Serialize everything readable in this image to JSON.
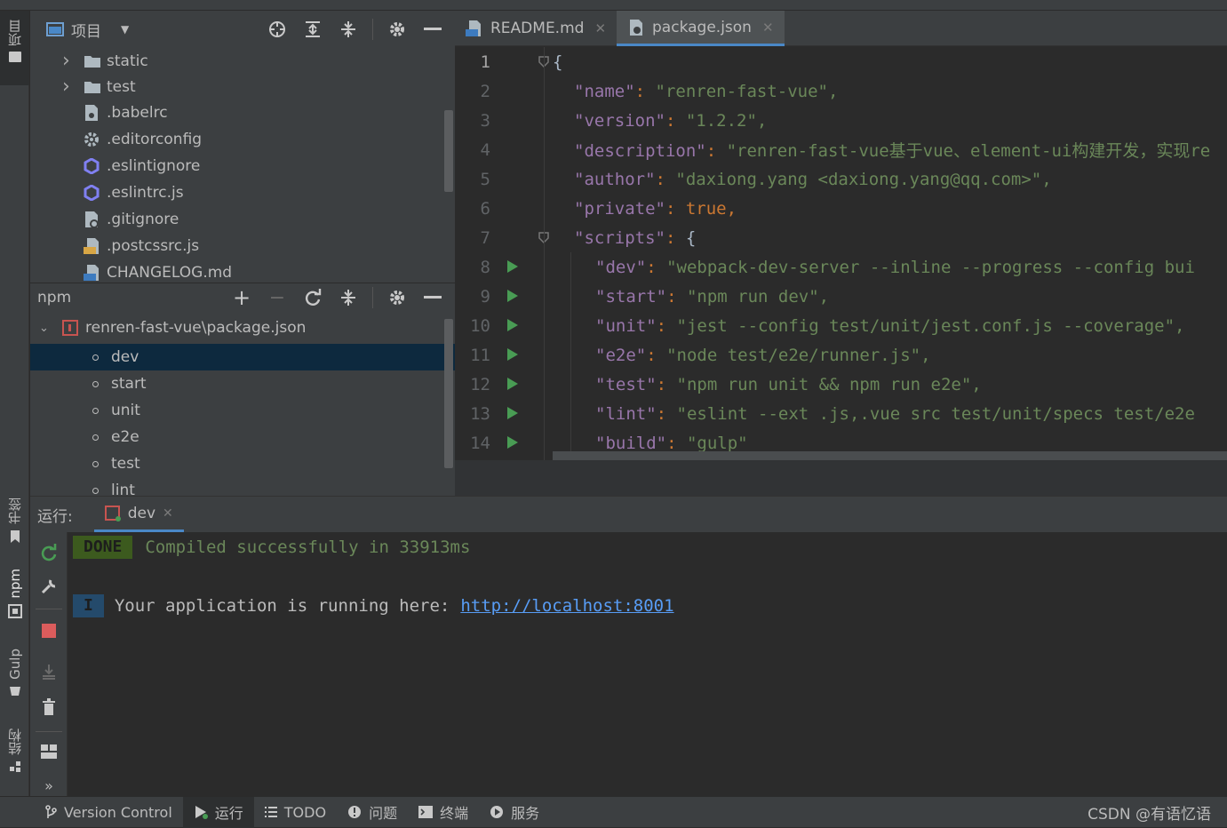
{
  "left_tool_strip": {
    "project_tab": "项目",
    "bookmarks_tab": "书签",
    "npm_tab": "npm",
    "gulp_tab": "Gulp",
    "structure_tab": "结构"
  },
  "project_panel": {
    "title": "项目",
    "tree": [
      {
        "label": "static",
        "type": "folder",
        "icon": "folder-icon"
      },
      {
        "label": "test",
        "type": "folder",
        "icon": "folder-icon"
      },
      {
        "label": ".babelrc",
        "type": "file",
        "icon": "config-file-icon"
      },
      {
        "label": ".editorconfig",
        "type": "file",
        "icon": "gear-file-icon"
      },
      {
        "label": ".eslintignore",
        "type": "file",
        "icon": "eslint-icon"
      },
      {
        "label": ".eslintrc.js",
        "type": "file",
        "icon": "eslint-icon"
      },
      {
        "label": ".gitignore",
        "type": "file",
        "icon": "ignore-file-icon"
      },
      {
        "label": ".postcssrc.js",
        "type": "file",
        "icon": "js-file-icon"
      },
      {
        "label": "CHANGELOG.md",
        "type": "file",
        "icon": "markdown-file-icon"
      }
    ]
  },
  "npm_panel": {
    "title": "npm",
    "package": "renren-fast-vue\\package.json",
    "scripts": [
      "dev",
      "start",
      "unit",
      "e2e",
      "test",
      "lint"
    ],
    "selected": "dev"
  },
  "editor": {
    "tabs": [
      {
        "label": "README.md",
        "icon": "markdown-file-icon",
        "active": false
      },
      {
        "label": "package.json",
        "icon": "json-file-icon",
        "active": true
      }
    ],
    "lines": [
      {
        "n": "1",
        "text": "{",
        "run": false
      },
      {
        "n": "2",
        "key": "\"name\"",
        "value": "\"renren-fast-vue\",",
        "run": false
      },
      {
        "n": "3",
        "key": "\"version\"",
        "value": "\"1.2.2\",",
        "run": false
      },
      {
        "n": "4",
        "key": "\"description\"",
        "value": "\"renren-fast-vue基于vue、element-ui构建开发，实现re",
        "run": false
      },
      {
        "n": "5",
        "key": "\"author\"",
        "value": "\"daxiong.yang <daxiong.yang@qq.com>\",",
        "run": false
      },
      {
        "n": "6",
        "key": "\"private\"",
        "value": "true,",
        "run": false
      },
      {
        "n": "7",
        "key": "\"scripts\"",
        "value": "{",
        "run": false
      },
      {
        "n": "8",
        "key": "\"dev\"",
        "value": "\"webpack-dev-server --inline --progress --config bui",
        "run": true
      },
      {
        "n": "9",
        "key": "\"start\"",
        "value": "\"npm run dev\",",
        "run": true
      },
      {
        "n": "10",
        "key": "\"unit\"",
        "value": "\"jest --config test/unit/jest.conf.js --coverage\",",
        "run": true
      },
      {
        "n": "11",
        "key": "\"e2e\"",
        "value": "\"node test/e2e/runner.js\",",
        "run": true
      },
      {
        "n": "12",
        "key": "\"test\"",
        "value": "\"npm run unit && npm run e2e\",",
        "run": true
      },
      {
        "n": "13",
        "key": "\"lint\"",
        "value": "\"eslint --ext .js,.vue src test/unit/specs test/e2e",
        "run": true
      },
      {
        "n": "14",
        "key": "\"build\"",
        "value": "\"gulp\"",
        "run": true
      }
    ]
  },
  "run_panel": {
    "label": "运行:",
    "tab": "dev",
    "done_badge": "DONE",
    "compiled_msg": "Compiled successfully in 33913ms",
    "info_badge": "I",
    "running_msg": "Your application is running here:",
    "url": "http://localhost:8001"
  },
  "status_bar": {
    "items": [
      {
        "label": "Version Control",
        "icon": "branch-icon"
      },
      {
        "label": "运行",
        "icon": "run-icon",
        "active": true
      },
      {
        "label": "TODO",
        "icon": "list-icon"
      },
      {
        "label": "问题",
        "icon": "problems-icon"
      },
      {
        "label": "终端",
        "icon": "terminal-icon"
      },
      {
        "label": "服务",
        "icon": "services-icon"
      }
    ],
    "watermark": "CSDN @有语忆语"
  },
  "colors": {
    "background": "#2b2b2b",
    "panel": "#3c3f41",
    "selection": "#0d293e",
    "key": "#9876aa",
    "string": "#6a8759",
    "keyword": "#cc7832",
    "run_green": "#499c54",
    "link": "#589df6"
  }
}
